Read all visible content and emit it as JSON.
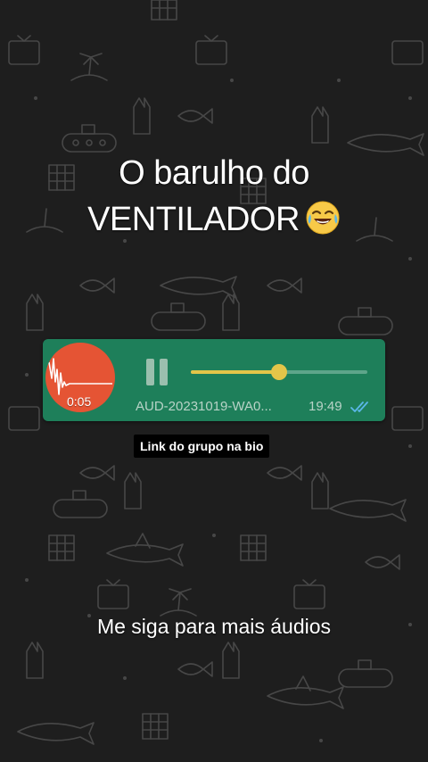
{
  "caption_top": {
    "line1": "O barulho do",
    "line2": "VENTILADOR",
    "emoji_icon": "face-with-tears-of-joy-icon"
  },
  "audio_message": {
    "avatar_time": "0:05",
    "filename": "AUD-20231019-WA0...",
    "timestamp": "19:49",
    "progress": 0.5,
    "play_state": "paused",
    "read_receipt_icon": "double-check-icon",
    "colors": {
      "bubble": "#1e7f5a",
      "avatar": "#e55434",
      "progress": "#e3c549",
      "ticks": "#5bb7e8"
    }
  },
  "overlay_label": "Link do grupo na bio",
  "caption_bottom": "Me siga para mais áudios",
  "wallpaper_icons": [
    "shark-icon",
    "submarine-icon",
    "palm-island-icon",
    "tv-icon",
    "anchor-icon",
    "fish-icon"
  ]
}
